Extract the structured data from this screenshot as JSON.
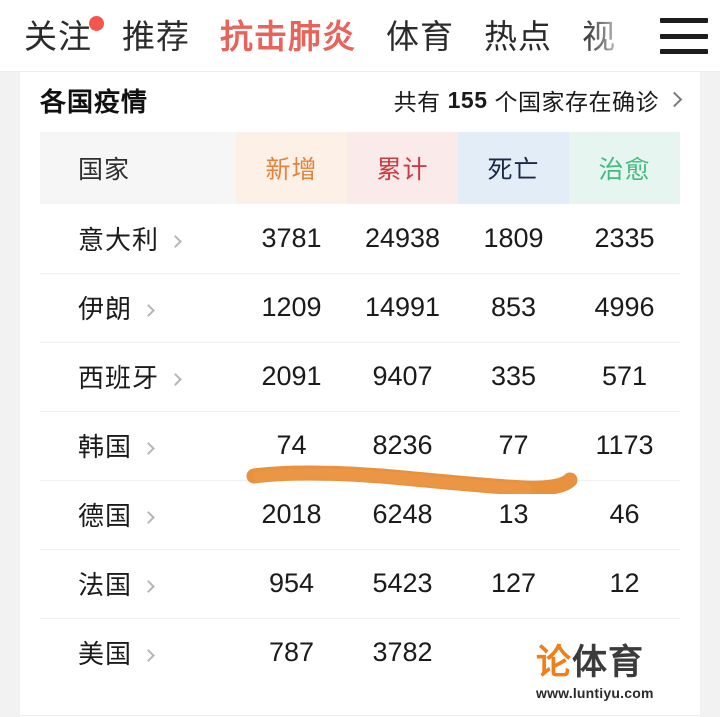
{
  "nav": {
    "items": [
      {
        "label": "关注",
        "state": "normal",
        "badge": true
      },
      {
        "label": "推荐",
        "state": "normal",
        "badge": false
      },
      {
        "label": "抗击肺炎",
        "state": "active",
        "badge": false
      },
      {
        "label": "体育",
        "state": "normal",
        "badge": false
      },
      {
        "label": "热点",
        "state": "normal",
        "badge": false
      },
      {
        "label": "视",
        "state": "clipped",
        "badge": false
      }
    ],
    "menu_icon": "hamburger-menu-icon",
    "active_color": "#e8645a",
    "badge_color": "#f4564e"
  },
  "section": {
    "title": "各国疫情",
    "more_prefix": "共有",
    "more_count": "155",
    "more_suffix": "个国家存在确诊",
    "more_chevron": "chevron-right-icon"
  },
  "table": {
    "columns": [
      {
        "key": "country",
        "label": "国家",
        "bg": "#f6f6f6",
        "color": "#2e2e2e"
      },
      {
        "key": "new",
        "label": "新增",
        "bg": "#fdf0e6",
        "color": "#e2843f"
      },
      {
        "key": "total",
        "label": "累计",
        "bg": "#fbeaea",
        "color": "#cc3b43"
      },
      {
        "key": "death",
        "label": "死亡",
        "bg": "#e3edf8",
        "color": "#1b2a44"
      },
      {
        "key": "cured",
        "label": "治愈",
        "bg": "#e6f5ef",
        "color": "#43bb7e"
      }
    ],
    "rows": [
      {
        "country": "意大利",
        "new": "3781",
        "total": "24938",
        "death": "1809",
        "cured": "2335"
      },
      {
        "country": "伊朗",
        "new": "1209",
        "total": "14991",
        "death": "853",
        "cured": "4996"
      },
      {
        "country": "西班牙",
        "new": "2091",
        "total": "9407",
        "death": "335",
        "cured": "571"
      },
      {
        "country": "韩国",
        "new": "74",
        "total": "8236",
        "death": "77",
        "cured": "1173"
      },
      {
        "country": "德国",
        "new": "2018",
        "total": "6248",
        "death": "13",
        "cured": "46"
      },
      {
        "country": "法国",
        "new": "954",
        "total": "5423",
        "death": "127",
        "cured": "12"
      },
      {
        "country": "美国",
        "new": "787",
        "total": "3782",
        "death": "",
        "cured": ""
      }
    ],
    "row_chevron": "chevron-right-icon"
  },
  "annotation": {
    "type": "hand-drawn-underline",
    "color": "#e8913f",
    "target_row": "西班牙"
  },
  "watermark": {
    "logo_accent": "论",
    "logo_dark": "体育",
    "url": "www.luntiyu.com",
    "accent_color": "#f07f1a"
  }
}
